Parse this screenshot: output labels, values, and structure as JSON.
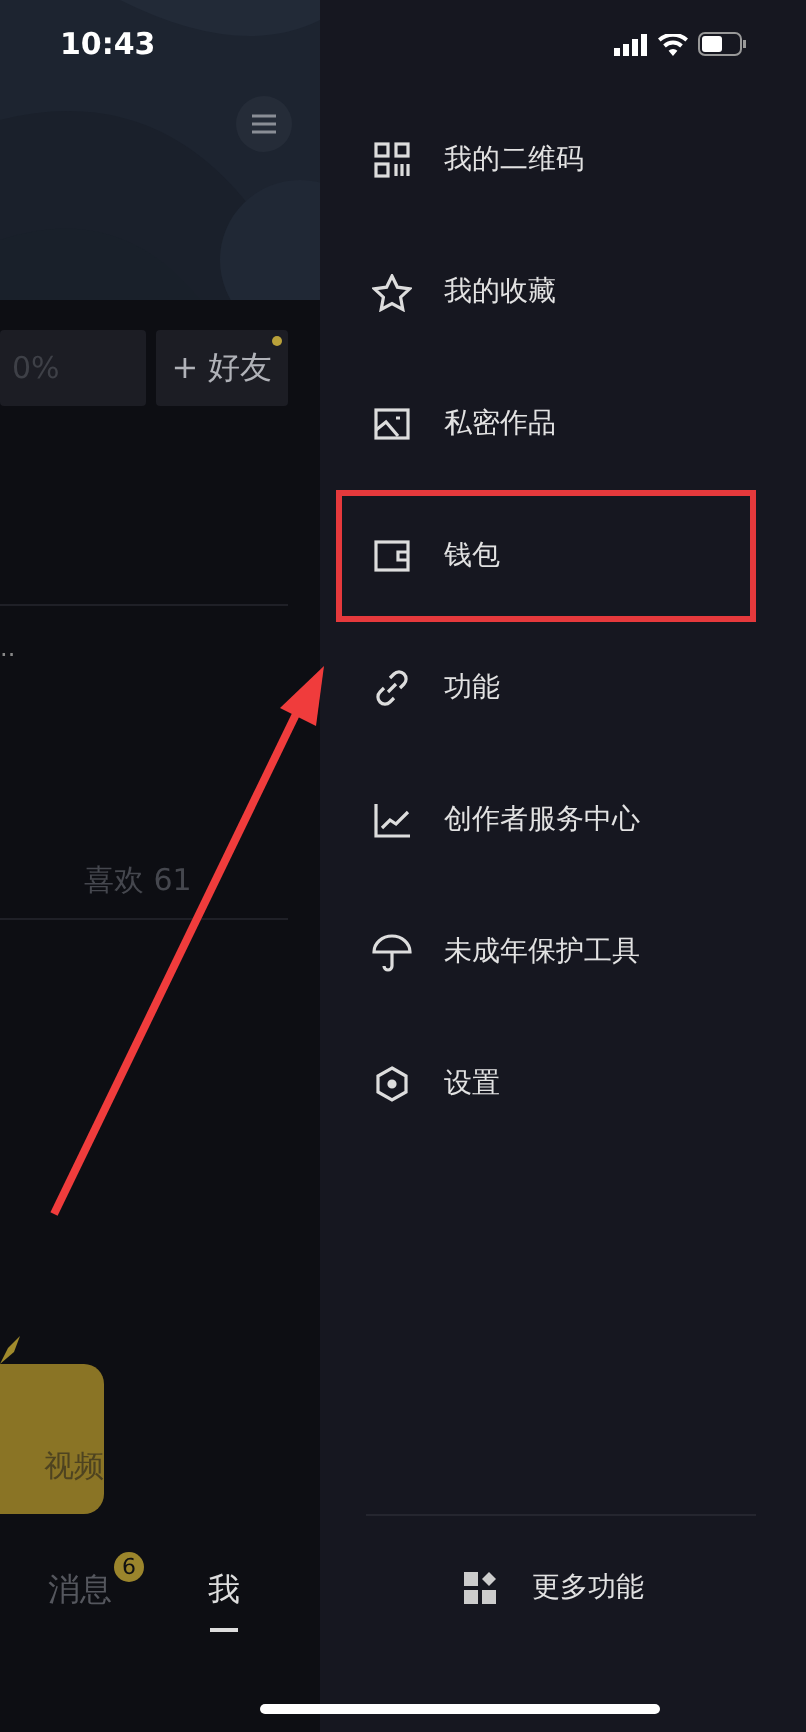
{
  "status_bar": {
    "time": "10:43"
  },
  "profile": {
    "buttons": [
      {
        "label": "0%",
        "dot": false
      },
      {
        "label": "+ 好友",
        "dot": true
      }
    ],
    "hint": "..",
    "likes": "喜欢 61",
    "card": {
      "label": "视频"
    },
    "tabs": [
      {
        "label": "消息",
        "badge": "6",
        "selected": false
      },
      {
        "label": "我",
        "selected": true
      }
    ]
  },
  "drawer": {
    "items": [
      {
        "label": "我的二维码",
        "highlighted": false
      },
      {
        "label": "我的收藏",
        "highlighted": false
      },
      {
        "label": "私密作品",
        "highlighted": false
      },
      {
        "label": "钱包",
        "highlighted": true
      },
      {
        "label": "功能",
        "highlighted": false
      },
      {
        "label": "创作者服务中心",
        "highlighted": false
      },
      {
        "label": "未成年保护工具",
        "highlighted": false
      },
      {
        "label": "设置",
        "highlighted": false
      }
    ],
    "more": {
      "label": "更多功能"
    }
  }
}
